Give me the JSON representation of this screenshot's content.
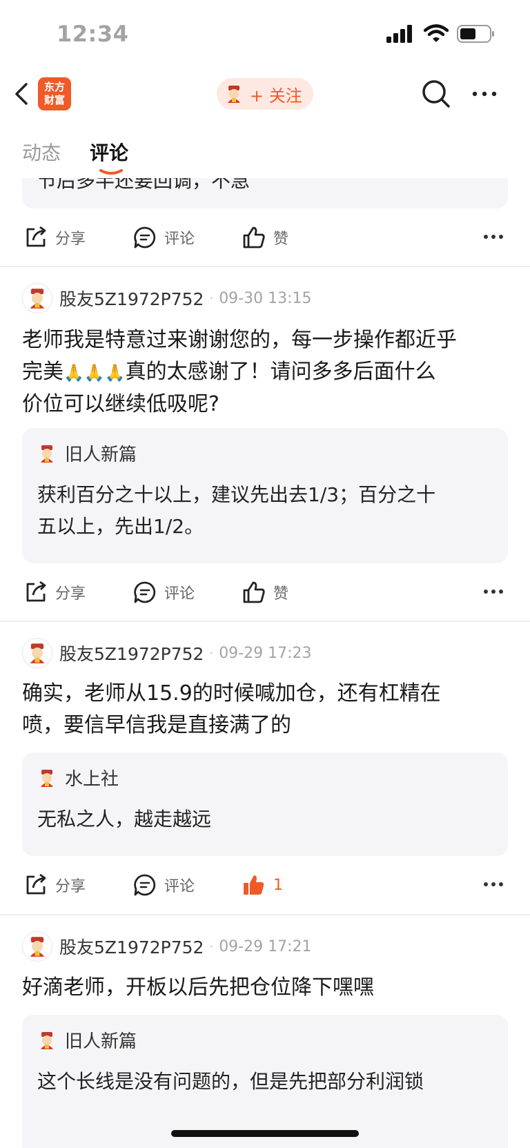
{
  "status": {
    "time": "12:34"
  },
  "nav": {
    "logo_line1": "东方",
    "logo_line2": "财富",
    "follow_label": "+ 关注"
  },
  "tabs": [
    {
      "label": "动态"
    },
    {
      "label": "评论"
    }
  ],
  "top_clip": {
    "text": "节后多半还要回调，不急"
  },
  "action_labels": {
    "share": "分享",
    "comment": "评论",
    "like": "赞"
  },
  "comments": [
    {
      "user": "股友5Z1972P752",
      "time": "09-30 13:15",
      "text_line1": "老师我是特意过来谢谢您的，每一步操作都近乎",
      "text_line2_a": "完美",
      "text_line2_b": "真的太感谢了！请问多多后面什么",
      "text_line3": "价位可以继续低吸呢?",
      "emoji": "🙏🙏🙏",
      "reply": {
        "name": "旧人新篇",
        "line1": "获利百分之十以上，建议先出去1/3；百分之十",
        "line2": "五以上，先出1/2。"
      },
      "like_label": "赞"
    },
    {
      "user": "股友5Z1972P752",
      "time": "09-29 17:23",
      "text_line1": "确实，老师从15.9的时候喊加仓，还有杠精在",
      "text_line2": "喷，要信早信我是直接满了的",
      "reply": {
        "name": "水上社",
        "line1": "无私之人，越走越远"
      },
      "like_count": "1"
    },
    {
      "user": "股友5Z1972P752",
      "time": "09-29 17:21",
      "text_line1": "好滴老师，开板以后先把仓位降下嘿嘿",
      "reply": {
        "name": "旧人新篇",
        "line1": "这个长线是没有问题的，但是先把部分利润锁"
      }
    }
  ],
  "colors": {
    "accent": "#f05a28",
    "reply_bg": "#f5f5f7"
  }
}
